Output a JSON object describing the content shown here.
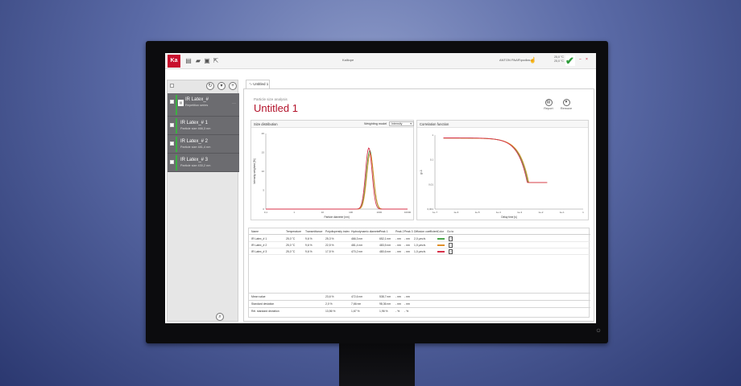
{
  "titlebar": {
    "logo": "Ka",
    "title": "Kalliope",
    "user": "ANTON PAAR\\podlas",
    "temp_line1": "25,0 °C",
    "temp_line2": "25,0 °C",
    "icons": [
      "new-file-icon",
      "open-folder-icon",
      "save-icon",
      "export-icon"
    ]
  },
  "sidebar": {
    "items": [
      {
        "name": "IR Latex_#",
        "sub": "Repetition series",
        "more": "⋯"
      },
      {
        "name": "IR Latex_# 1",
        "sub": "Particle size 466,3 nm"
      },
      {
        "name": "IR Latex_# 2",
        "sub": "Particle size 481,4 nm"
      },
      {
        "name": "IR Latex_# 3",
        "sub": "Particle size 430,2 nm"
      }
    ]
  },
  "tab": {
    "label": "Untitled 1"
  },
  "main": {
    "subtitle": "Particle size analysis",
    "title": "Untitled 1",
    "actions": [
      {
        "label": "Report"
      },
      {
        "label": "Remove"
      }
    ]
  },
  "size_panel": {
    "title": "Size distribution",
    "weighting_label": "Weighting model",
    "weighting_value": "Intensity"
  },
  "corr_panel": {
    "title": "Correlation function"
  },
  "colors": {
    "series1": "#4aa64a",
    "series2": "#e0902a",
    "series3": "#d8314a",
    "accent": "#b3122a"
  },
  "chart_data": [
    {
      "type": "line",
      "title": "Size distribution",
      "xlabel": "Particle diameter [nm]",
      "ylabel": "Intensity weighted [%]",
      "x_log": true,
      "xlim": [
        0.1,
        10000
      ],
      "x_ticks": [
        "0,1",
        "1",
        "10",
        "100",
        "1000",
        "10000"
      ],
      "ylim": [
        0,
        20
      ],
      "y_ticks": [
        "0",
        "5",
        "10",
        "15",
        "20"
      ],
      "series": [
        {
          "peak_x": 466,
          "peak_y": 15.5,
          "width": 0.12
        },
        {
          "peak_x": 481,
          "peak_y": 14.7,
          "width": 0.12
        },
        {
          "peak_x": 430,
          "peak_y": 16.2,
          "width": 0.115
        }
      ]
    },
    {
      "type": "line",
      "title": "Correlation function",
      "xlabel": "Delay time [s]",
      "ylabel": "g²-1",
      "x_log": true,
      "xlim": [
        1e-07,
        1
      ],
      "x_ticks": [
        "1e-7",
        "1e-6",
        "1e-5",
        "1e-4",
        "1e-3",
        "1e-2",
        "1e-1",
        "1"
      ],
      "y_log": true,
      "ylim": [
        0.001,
        1
      ],
      "y_ticks": [
        "0,001",
        "0,01",
        "0,1",
        "1"
      ],
      "series": [
        {
          "decay_time": 0.0012,
          "plateau": 0.76
        },
        {
          "decay_time": 0.0013,
          "plateau": 0.75
        },
        {
          "decay_time": 0.0011,
          "plateau": 0.77
        }
      ]
    }
  ],
  "table": {
    "headers": [
      "Name",
      "Temperature",
      "Transmittance",
      "Polydispersity index",
      "Hydrodynamic diameter",
      "Peak 1",
      "Peak 2",
      "Peak 3",
      "Diffusion coefficient",
      "Color",
      "Go to"
    ],
    "rows": [
      {
        "name": "IR Latex_# 1",
        "temp": "25,0 °C",
        "trans": "9,6 %",
        "pdi": "25,3 %",
        "hd": "466,3 nm",
        "p1": "652,1 nm",
        "p2": "- nm",
        "p3": "- nm",
        "diff": "2,0 µm²/s",
        "color": "#4aa64a"
      },
      {
        "name": "IR Latex_# 2",
        "temp": "25,0 °C",
        "trans": "9,6 %",
        "pdi": "22,5 %",
        "hd": "481,4 nm",
        "p1": "483,5 nm",
        "p2": "- nm",
        "p3": "- nm",
        "diff": "1,0 µm²/s",
        "color": "#e0902a"
      },
      {
        "name": "IR Latex_# 3",
        "temp": "25,0 °C",
        "trans": "9,6 %",
        "pdi": "17,5 %",
        "hd": "470,2 nm",
        "p1": "480,6 nm",
        "p2": "- nm",
        "p3": "- nm",
        "diff": "1,0 µm²/s",
        "color": "#d8314a"
      }
    ],
    "summary": [
      {
        "label": "Mean value",
        "pdi": "23,6 %",
        "hd": "472,6 nm",
        "p1": "538,7 nm",
        "p2": "- nm",
        "p3": "- nm"
      },
      {
        "label": "Standard deviation",
        "pdi": "2,0 %",
        "hd": "7,66 nm",
        "p1": "98,36 nm",
        "p2": "- nm",
        "p3": "- nm"
      },
      {
        "label": "Rel. standard deviation",
        "pdi": "13,56 %",
        "hd": "1,67 %",
        "p1": "1,96 %",
        "p2": "- %",
        "p3": "- %"
      }
    ]
  }
}
